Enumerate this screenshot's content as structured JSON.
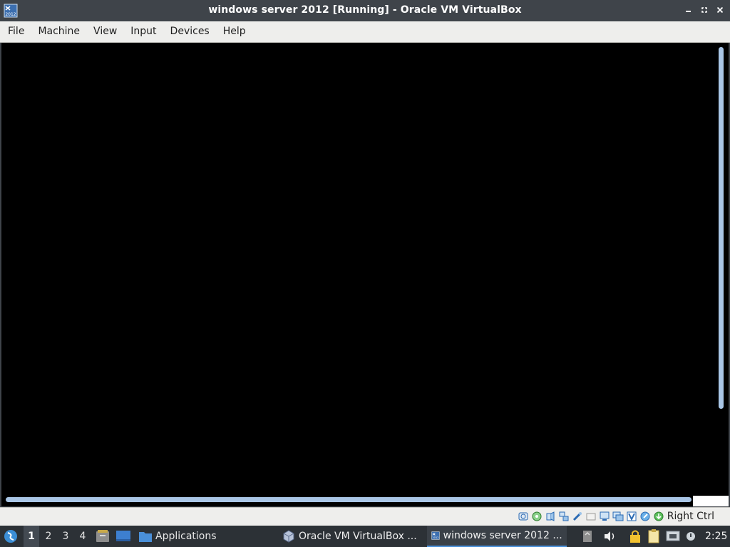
{
  "window": {
    "title": "windows server 2012 [Running] - Oracle VM VirtualBox",
    "icon": "virtualbox-vm-2012-icon",
    "icon_badge": "2012"
  },
  "menubar": {
    "items": [
      {
        "label": "File"
      },
      {
        "label": "Machine"
      },
      {
        "label": "View"
      },
      {
        "label": "Input"
      },
      {
        "label": "Devices"
      },
      {
        "label": "Help"
      }
    ]
  },
  "statusbar": {
    "icons": [
      "hard-disk-icon",
      "optical-drive-icon",
      "audio-icon",
      "network-icon",
      "usb-icon",
      "shared-folders-icon",
      "display-icon",
      "recording-icon",
      "vt-x-icon",
      "mouse-integration-icon",
      "keyboard-capture-icon"
    ],
    "host_key": "Right Ctrl"
  },
  "taskbar": {
    "workspaces": [
      "1",
      "2",
      "3",
      "4"
    ],
    "active_workspace": "1",
    "launcher_label": "Applications",
    "tasks": [
      {
        "label": "Oracle VM VirtualBox ...",
        "icon": "virtualbox-icon",
        "active": false
      },
      {
        "label": "windows server 2012 ...",
        "icon": "virtualbox-vm-2012-icon",
        "active": true
      }
    ],
    "clock": "2:25"
  },
  "colors": {
    "titlebar": "#3f444a",
    "menubar": "#eeeeec",
    "vm_screen": "#000000",
    "scroll_thumb": "#a9c6e6",
    "taskbar": "#2c3136",
    "accent": "#4a90d9"
  }
}
